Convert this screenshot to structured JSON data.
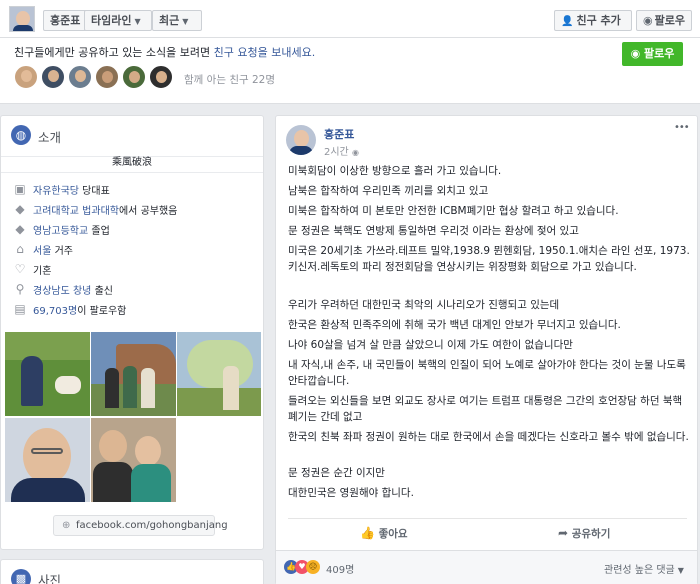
{
  "header": {
    "name_button": "홍준표",
    "timeline_button": "타임라인",
    "recent_button": "최근",
    "add_friend_button": "친구 추가",
    "follow_button": "팔로우"
  },
  "share_notice": {
    "text_prefix": "친구들에게만 공유하고 있는 소식을 보려면 ",
    "link_text": "친구 요청을 보내세요.",
    "follow_button": "팔로우",
    "mutual_friends": "함께 아는 친구 22명"
  },
  "intro": {
    "title": "소개",
    "motto": "乘風破浪",
    "items": [
      {
        "icon": "briefcase-icon",
        "link": "자유한국당",
        "text": " 당대표"
      },
      {
        "icon": "graduation-cap-icon",
        "link": "고려대학교 법과대학",
        "text": "에서 공부했음"
      },
      {
        "icon": "graduation-cap-icon",
        "link": "영남고등학교",
        "text": " 졸업"
      },
      {
        "icon": "home-icon",
        "link": "서울",
        "text": " 거주"
      },
      {
        "icon": "heart-icon",
        "link": "",
        "text": "기혼"
      },
      {
        "icon": "location-pin-icon",
        "link": "경상남도 창녕",
        "text": " 출신"
      },
      {
        "icon": "follower-icon",
        "link": "69,703명",
        "text": "이 팔로우함"
      }
    ],
    "website": "facebook.com/gohongbanjang"
  },
  "photos_card": {
    "title": "사진"
  },
  "post": {
    "author": "홍준표",
    "time": "2시간",
    "options": "•••",
    "lines": [
      "미북회담이 이상한 방향으로 흘러 가고 있습니다.",
      "남북은 합작하여 우리민족 끼리를 외치고 있고",
      "미북은 합작하여 미 본토만 안전한 ICBM폐기만 협상 할려고 하고 있습니다.",
      "문 정권은 북핵도 연방제 통일하면 우리것 이라는 환상에 젖어 있고",
      "미국은 20세기초 가쓰라.테프트 밀약,1938.9 뮌헨회담, 1950.1.애치슨 라인 선포, 1973.키신저.레독토의 파리 정전회담을 연상시키는 위장평화 회담으로 가고 있습니다.",
      "우리가 우려하던 대한민국 최악의 시나리오가 진행되고 있는데",
      "한국은 환상적 민족주의에 취해 국가 백년 대계인 안보가 무너지고 있습니다.",
      "나야 60살을 넘겨 살 만큼 살았으니 이제 가도 여한이 없습니다만",
      "내 자식,내 손주, 내 국민들이 북핵의 인질이 되어 노예로 살아가야 한다는 것이 눈물 나도록 안타깝습니다.",
      "들려오는 외신들을 보면 외교도 장사로 여기는 트럼프 대통령은 그간의 호언장담 하던 북핵 폐기는 간데 없고",
      "한국의 친북 좌파 정권이 원하는 대로 한국에서 손을 떼겠다는 신호라고 볼수 밖에 없습니다.",
      "문 정권은 순간 이지만",
      "대한민국은 영원해야 합니다."
    ],
    "like_button": "좋아요",
    "share_button": "공유하기",
    "reaction_count": "409명",
    "sort_label": "관련성 높은 댓글"
  },
  "colors": {
    "link": "#365899",
    "accent_green": "#42b72a",
    "background": "#e9ebee"
  }
}
